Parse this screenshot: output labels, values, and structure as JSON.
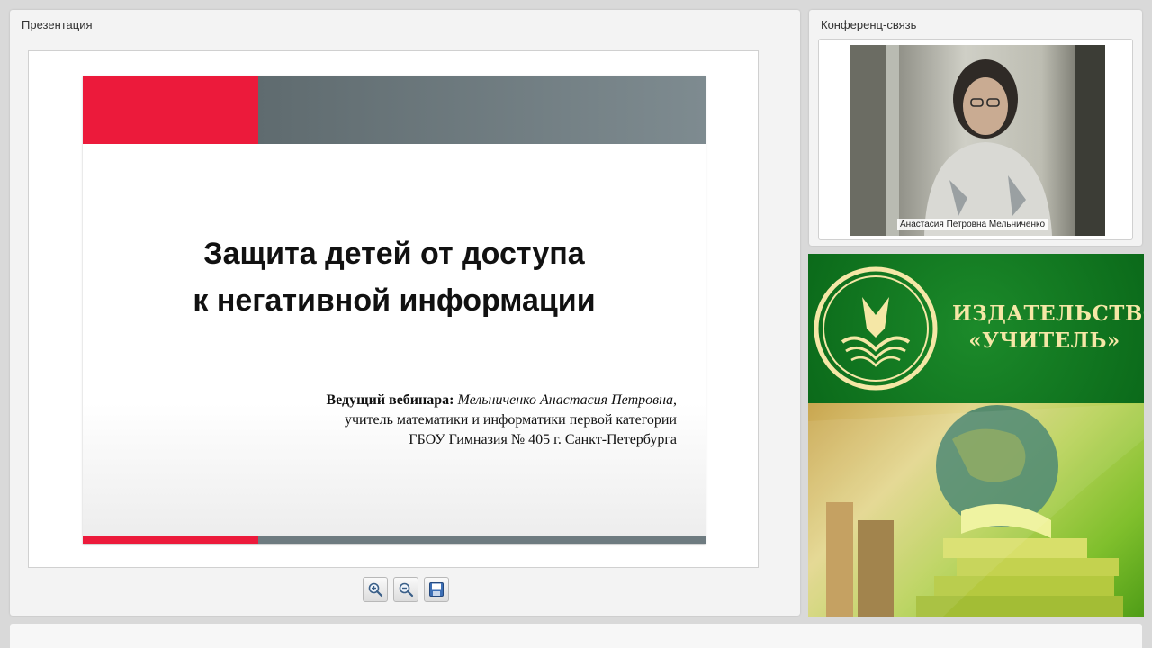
{
  "presentation": {
    "title": "Презентация",
    "slide": {
      "title_line1": "Защита детей от доступа",
      "title_line2": "к негативной информации",
      "host_label": "Ведущий вебинара:",
      "host_name": "Мельниченко Анастасия Петровна",
      "host_role": "учитель математики и информатики первой категории",
      "host_school": "ГБОУ Гимназия № 405 г. Санкт-Петербурга",
      "accent_red": "#ec1a3b",
      "accent_gray": "#6e7b80"
    },
    "tools": {
      "zoom_in": "zoom-in-icon",
      "zoom_out": "zoom-out-icon",
      "save": "save-icon"
    }
  },
  "conference": {
    "title": "Конференц-связь",
    "participant_name": "Анастасия Петровна Мельниченко"
  },
  "ad": {
    "line1": "ИЗДАТЕЛЬСТВО",
    "line2": "«УЧИТЕЛЬ»",
    "brand_green": "#0b6a1a",
    "text_color": "#f5e7a6"
  }
}
